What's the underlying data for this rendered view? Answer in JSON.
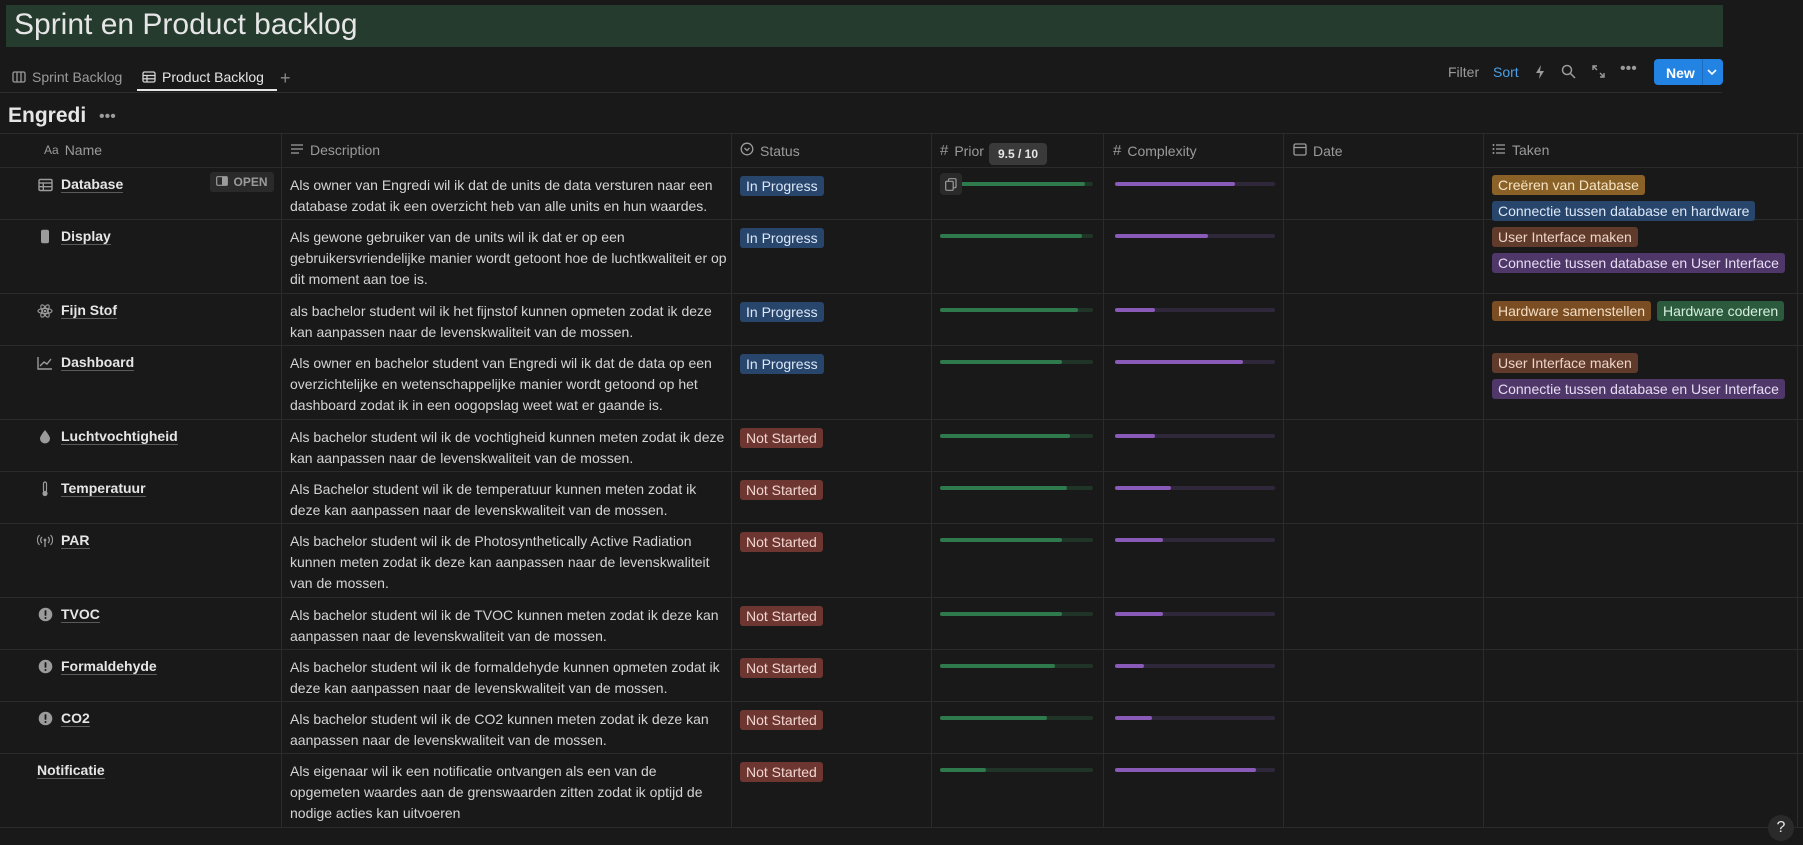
{
  "page": {
    "title": "Sprint en Product backlog"
  },
  "tabs": [
    {
      "label": "Sprint Backlog",
      "icon": "columns-icon",
      "active": false
    },
    {
      "label": "Product Backlog",
      "icon": "table-icon",
      "active": true
    }
  ],
  "toolbar": {
    "filter": "Filter",
    "sort": "Sort",
    "new": "New"
  },
  "group": {
    "title": "Engredi"
  },
  "columns": {
    "name": "Name",
    "description": "Description",
    "status": "Status",
    "priority": "Prior",
    "complexity": "Complexity",
    "date": "Date",
    "taken": "Taken"
  },
  "tooltip": "9.5 / 10",
  "open_label": "OPEN",
  "status_colors": {
    "In Progress": "#28456c",
    "Not Started": "#6e3630"
  },
  "rows": [
    {
      "name": "Database",
      "icon": "table-icon",
      "description": "Als owner van Engredi wil ik dat de units de data versturen naar een database zodat ik een overzicht heb van alle units en hun waardes.",
      "status": "In Progress",
      "priority": 0.95,
      "complexity": 0.75,
      "taken": [
        "Creëren van Database",
        "Connectie tussen database en hardware"
      ]
    },
    {
      "name": "Display",
      "icon": "phone-icon",
      "description": "Als gewone gebruiker van de units wil ik dat er op een gebruikersvriendelijke manier wordt getoont hoe de luchtkwaliteit er op dit moment aan toe is.",
      "status": "In Progress",
      "priority": 0.93,
      "complexity": 0.58,
      "taken": [
        "User Interface maken",
        "Connectie tussen database en User Interface"
      ]
    },
    {
      "name": "Fijn Stof",
      "icon": "atom-icon",
      "description": "als bachelor student wil ik het fijnstof kunnen opmeten zodat ik deze kan aanpassen naar de levenskwaliteit van de mossen.",
      "status": "In Progress",
      "priority": 0.9,
      "complexity": 0.25,
      "taken": [
        "Hardware samenstellen",
        "Hardware coderen"
      ]
    },
    {
      "name": "Dashboard",
      "icon": "chart-icon",
      "description": "Als owner en bachelor student van Engredi wil ik dat de data op een overzichtelijke en wetenschappelijke manier wordt getoond op het dashboard zodat ik in een oogopslag weet wat er gaande is.",
      "status": "In Progress",
      "priority": 0.8,
      "complexity": 0.8,
      "taken": [
        "User Interface maken",
        "Connectie tussen database en User Interface"
      ]
    },
    {
      "name": "Luchtvochtigheid",
      "icon": "drop-icon",
      "description": "Als bachelor student wil ik de vochtigheid kunnen meten zodat ik deze kan aanpassen naar de levenskwaliteit van de mossen.",
      "status": "Not Started",
      "priority": 0.85,
      "complexity": 0.25,
      "taken": []
    },
    {
      "name": "Temperatuur",
      "icon": "thermometer-icon",
      "description": "Als Bachelor student wil ik de temperatuur kunnen meten zodat ik deze kan aanpassen naar de levenskwaliteit van de mossen.",
      "status": "Not Started",
      "priority": 0.83,
      "complexity": 0.35,
      "taken": []
    },
    {
      "name": "PAR",
      "icon": "broadcast-icon",
      "description": "Als bachelor student wil ik de Photosynthetically Active Radiation kunnen meten zodat ik deze kan aanpassen naar de levenskwaliteit van de mossen.",
      "status": "Not Started",
      "priority": 0.8,
      "complexity": 0.3,
      "taken": []
    },
    {
      "name": "TVOC",
      "icon": "alert-icon",
      "description": "Als bachelor student wil ik de TVOC kunnen meten zodat ik deze kan aanpassen naar de levenskwaliteit van de mossen.",
      "status": "Not Started",
      "priority": 0.8,
      "complexity": 0.3,
      "taken": []
    },
    {
      "name": "Formaldehyde",
      "icon": "alert-icon",
      "description": "Als bachelor student wil ik de formaldehyde kunnen opmeten zodat ik deze kan aanpassen naar de levenskwaliteit van de mossen.",
      "status": "Not Started",
      "priority": 0.75,
      "complexity": 0.18,
      "taken": []
    },
    {
      "name": "CO2",
      "icon": "alert-icon",
      "description": "Als bachelor student wil ik de CO2 kunnen meten zodat ik deze kan aanpassen naar de levenskwaliteit van de mossen.",
      "status": "Not Started",
      "priority": 0.7,
      "complexity": 0.23,
      "taken": []
    },
    {
      "name": "Notificatie",
      "icon": "",
      "description": "Als eigenaar wil ik een notificatie ontvangen als een van de opgemeten waardes aan de grenswaarden zitten zodat ik optijd de nodige acties kan uitvoeren",
      "status": "Not Started",
      "priority": 0.3,
      "complexity": 0.88,
      "taken": []
    }
  ]
}
